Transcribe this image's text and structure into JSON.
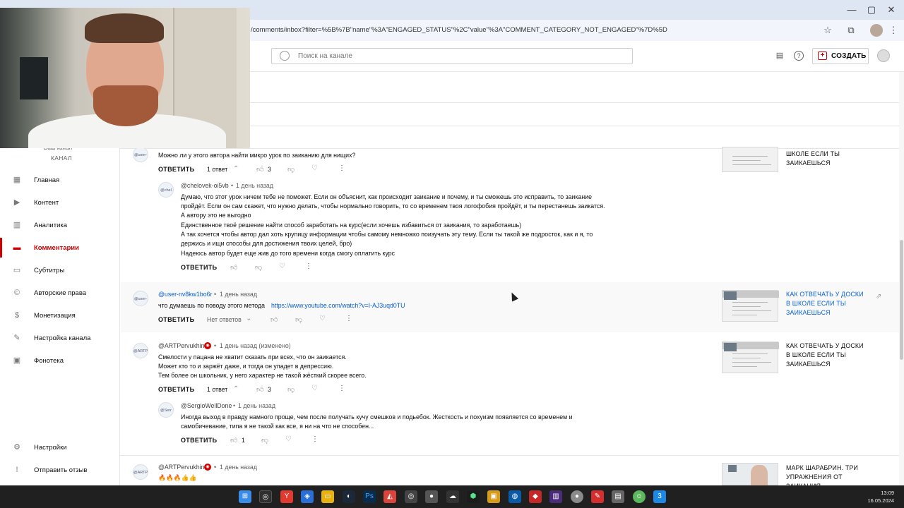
{
  "browser": {
    "url": "/comments/inbox?filter=%5B%7B\"name\"%3A\"ENGAGED_STATUS\"%2C\"value\"%3A\"COMMENT_CATEGORY_NOT_ENGAGED\"%7D%5D",
    "window_minimize": "—",
    "window_maximize": "▢",
    "window_close": "✕"
  },
  "header": {
    "search_placeholder": "Поиск на канале",
    "create_label": "СОЗДАТЬ"
  },
  "sidebar": {
    "channel_name": "Ваш канал",
    "channel_label": "КАНАЛ",
    "items": [
      {
        "label": "Главная",
        "icon": "dashboard-icon"
      },
      {
        "label": "Контент",
        "icon": "content-icon"
      },
      {
        "label": "Аналитика",
        "icon": "analytics-icon"
      },
      {
        "label": "Комментарии",
        "icon": "comments-icon",
        "active": true
      },
      {
        "label": "Субтитры",
        "icon": "subtitles-icon"
      },
      {
        "label": "Авторские права",
        "icon": "copyright-icon"
      },
      {
        "label": "Монетизация",
        "icon": "monetization-icon"
      },
      {
        "label": "Настройка канала",
        "icon": "customization-icon"
      },
      {
        "label": "Фонотека",
        "icon": "audio-library-icon"
      }
    ],
    "bottom_items": [
      {
        "label": "Настройки",
        "icon": "settings-icon"
      },
      {
        "label": "Отправить отзыв",
        "icon": "feedback-icon"
      }
    ]
  },
  "comments": {
    "c1": {
      "avatar_label": "@user-",
      "text": "Можно ли у этого автора найти микро урок по заиканию для нищих?",
      "reply": "ОТВЕТИТЬ",
      "replies_count": "1 ответ",
      "likes": "3",
      "video_title": "ШКОЛЕ ЕСЛИ ТЫ ЗАИКАЕШЬСЯ"
    },
    "r1": {
      "avatar_label": "@chel",
      "author": "@chelovek-oi5vb",
      "time": "1 день назад",
      "lines": [
        "Думаю, что этот урок ничем тебе не поможет. Если он объяснит, как происходит заикание и почему, и ты сможешь это исправить, то заикание",
        "пройдёт. Если он сам скажет, что нужно делать, чтобы нормально говорить, то со временем твоя логофобия пройдёт, и ты перестанешь заикатся.",
        "А автору это не выгодно",
        "Единственное твоё решение найти способ заработать на курс(если хочешь избавиться от заикания, то заработаешь)",
        "А так хочется чтобы автор дал хоть крупицу информации чтобы самому немножко поизучать эту тему. Если ты такой же подросток, как и я, то",
        "держись и ищи способы для достижения твоих целей, бро)",
        "Надеюсь автор будет еще жив до того времени когда смогу оплатить курс"
      ],
      "reply": "ОТВЕТИТЬ"
    },
    "c2": {
      "avatar_label": "@user-",
      "author": "@user-nv8kw1bo6r",
      "time": "1 день назад",
      "text": "что думаешь по поводу этого метода",
      "link": "https://www.youtube.com/watch?v=I-AJ3uqd0TU",
      "reply": "ОТВЕТИТЬ",
      "replies_count": "Нет ответов",
      "video_title": "КАК ОТВЕЧАТЬ У ДОСКИ В ШКОЛЕ ЕСЛИ ТЫ ЗАИКАЕШЬСЯ"
    },
    "c3": {
      "avatar_label": "@ARTPe",
      "author": "@ARTPervukhin",
      "time": "1 день назад (изменено)",
      "lines": [
        "Смелости у пацана не хватит сказать при всех, что он заикается.",
        "Может кто то и заржёт даже, и тогда он упадет в депрессию.",
        "Тем более он школьник, у него характер не такой жёсткий скорее всего."
      ],
      "reply": "ОТВЕТИТЬ",
      "replies_count": "1 ответ",
      "likes": "3",
      "video_title": "КАК ОТВЕЧАТЬ У ДОСКИ В ШКОЛЕ ЕСЛИ ТЫ ЗАИКАЕШЬСЯ"
    },
    "r3": {
      "avatar_label": "@Serr",
      "author": "@SergioWellDone",
      "time": "1 день назад",
      "lines": [
        "Иногда выход в правду намного проще, чем после получать кучу смешков и подьебок. Жесткость и похуизм появляется со временем и",
        "самобичевание, типа я не такой как все, я ни на что не способен..."
      ],
      "reply": "ОТВЕТИТЬ",
      "likes": "1"
    },
    "c4": {
      "avatar_label": "@ARTPe",
      "author": "@ARTPervukhin",
      "time": "1 день назад",
      "text": "🔥🔥🔥👍👍",
      "video_title": "МАРК ШАРАБРИН. ТРИ УПРАЖНЕНИЯ ОТ ЗАИКАНИЯ"
    }
  },
  "taskbar": {
    "time": "13:09",
    "date": "16.05.2024"
  },
  "colors": {
    "accent": "#cc0000",
    "link": "#065fd4"
  }
}
